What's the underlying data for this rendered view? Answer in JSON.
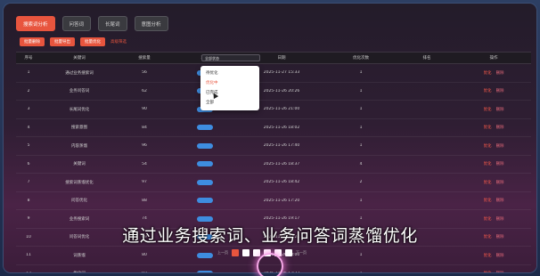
{
  "tabs": [
    "搜索词分析",
    "问答词",
    "长尾词",
    "意图分析"
  ],
  "toolbar": {
    "btn1": "批量删除",
    "btn2": "批量导出",
    "btn3": "批量优化",
    "link": "高级筛选"
  },
  "table": {
    "headers": [
      "序号",
      "关键词",
      "搜索量",
      "状态",
      "日期",
      "优化次数",
      "排名",
      "操作"
    ],
    "rows": [
      {
        "n": "1",
        "kw": "通过业务搜索词",
        "vol": "56",
        "date": "2025-11-27 15:33",
        "cnt": "1",
        "rank": "",
        "op1": "优化",
        "op2": "删除"
      },
      {
        "n": "2",
        "kw": "业务问答词",
        "vol": "62",
        "date": "2025-11-26 20:26",
        "cnt": "1",
        "rank": "",
        "op1": "优化",
        "op2": "删除"
      },
      {
        "n": "3",
        "kw": "长尾词优化",
        "vol": "90",
        "date": "2025-11-26 21:00",
        "cnt": "1",
        "rank": "",
        "op1": "优化",
        "op2": "删除"
      },
      {
        "n": "4",
        "kw": "搜索意图",
        "vol": "84",
        "date": "2025-11-26 18:02",
        "cnt": "1",
        "rank": "",
        "op1": "优化",
        "op2": "删除"
      },
      {
        "n": "5",
        "kw": "内容蒸馏",
        "vol": "96",
        "date": "2025-11-26 17:40",
        "cnt": "1",
        "rank": "",
        "op1": "优化",
        "op2": "删除"
      },
      {
        "n": "6",
        "kw": "关键词",
        "vol": "54",
        "date": "2025-11-26 18:37",
        "cnt": "4",
        "rank": "",
        "op1": "优化",
        "op2": "删除"
      },
      {
        "n": "7",
        "kw": "搜索词蒸馏优化",
        "vol": "97",
        "date": "2025-11-26 18:42",
        "cnt": "2",
        "rank": "",
        "op1": "优化",
        "op2": "删除"
      },
      {
        "n": "8",
        "kw": "问答优化",
        "vol": "88",
        "date": "2025-11-26 17:20",
        "cnt": "1",
        "rank": "",
        "op1": "优化",
        "op2": "删除"
      },
      {
        "n": "9",
        "kw": "业务搜索词",
        "vol": "74",
        "date": "2025-11-26 19:17",
        "cnt": "1",
        "rank": "",
        "op1": "优化",
        "op2": "删除"
      },
      {
        "n": "10",
        "kw": "问答词优化",
        "vol": "69",
        "date": "2025-11-26 20:24",
        "cnt": "1",
        "rank": "",
        "op1": "优化",
        "op2": "删除"
      },
      {
        "n": "11",
        "kw": "词蒸馏",
        "vol": "80",
        "date": "2025-11-26 18:00",
        "cnt": "1",
        "rank": "",
        "op1": "优化",
        "op2": "删除"
      },
      {
        "n": "12",
        "kw": "优化词",
        "vol": "92",
        "date": "2025-11-26 17:33",
        "cnt": "1",
        "rank": "",
        "op1": "优化",
        "op2": "删除"
      }
    ]
  },
  "status_select": {
    "value": "全部状态",
    "options": [
      "待优化",
      "优化中",
      "已完成",
      "全部"
    ],
    "selected_index": 1
  },
  "subtitle": "通过业务搜索词、业务问答词蒸馏优化",
  "pager": {
    "prev": "上一页",
    "next": "下一页"
  },
  "colors": {
    "accent": "#e8553e",
    "pill": "#3e8de0"
  }
}
